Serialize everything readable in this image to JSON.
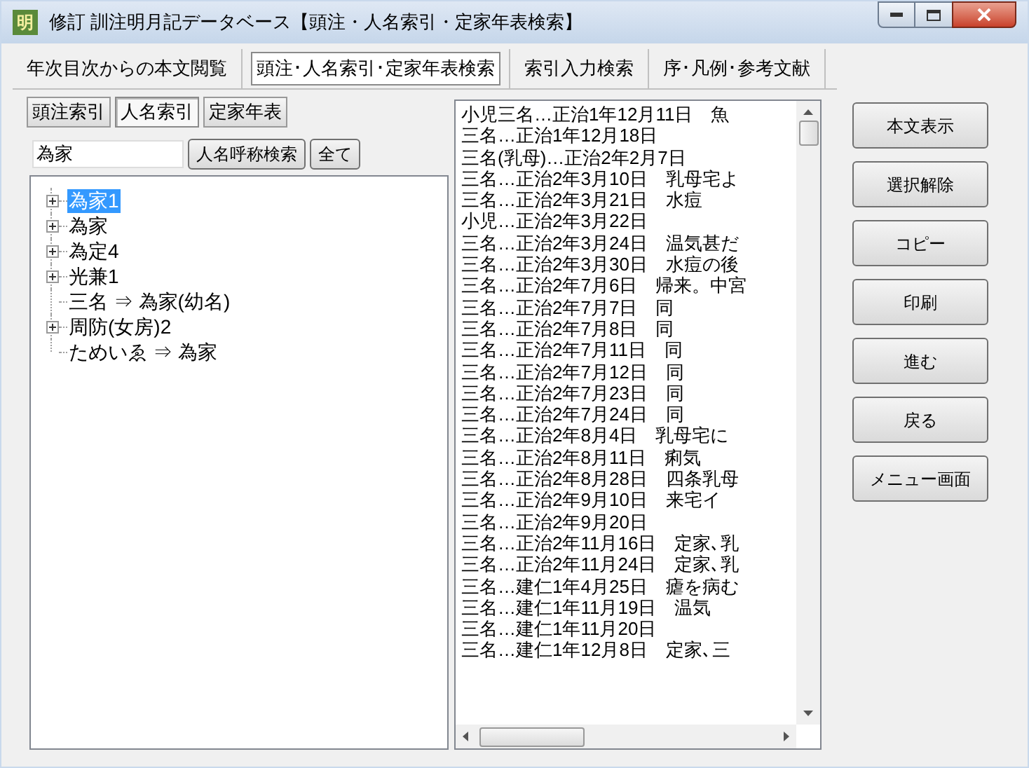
{
  "window": {
    "app_icon": "明",
    "title": "修訂 訓注明月記データベース【頭注・人名索引・定家年表検索】"
  },
  "tabs": [
    {
      "label": "年次目次からの本文閲覧",
      "selected": false
    },
    {
      "label": "頭注･人名索引･定家年表検索",
      "selected": true
    },
    {
      "label": "索引入力検索",
      "selected": false
    },
    {
      "label": "序･凡例･参考文献",
      "selected": false
    }
  ],
  "sub_tabs": [
    {
      "label": "頭注索引",
      "selected": false
    },
    {
      "label": "人名索引",
      "selected": true
    },
    {
      "label": "定家年表",
      "selected": false
    }
  ],
  "search": {
    "value": "為家",
    "buttons": [
      "人名呼称検索",
      "全て"
    ]
  },
  "tree": [
    {
      "label": "為家1",
      "expandable": true,
      "selected": true
    },
    {
      "label": "為家",
      "expandable": true,
      "selected": false
    },
    {
      "label": "為定4",
      "expandable": true,
      "selected": false
    },
    {
      "label": "光兼1",
      "expandable": true,
      "selected": false
    },
    {
      "label": "三名 ⇒ 為家(幼名)",
      "expandable": false,
      "selected": false
    },
    {
      "label": "周防(女房)2",
      "expandable": true,
      "selected": false
    },
    {
      "label": "ためいゑ ⇒ 為家",
      "expandable": false,
      "selected": false
    }
  ],
  "results": [
    "小児三名…正治1年12月11日　魚",
    "三名…正治1年12月18日",
    "三名(乳母)…正治2年2月7日",
    "三名…正治2年3月10日　乳母宅よ",
    "三名…正治2年3月21日　水痘",
    "小児…正治2年3月22日",
    "三名…正治2年3月24日　温気甚だ",
    "三名…正治2年3月30日　水痘の後",
    "三名…正治2年7月6日　帰来。中宮",
    "三名…正治2年7月7日　同",
    "三名…正治2年7月8日　同",
    "三名…正治2年7月11日　同",
    "三名…正治2年7月12日　同",
    "三名…正治2年7月23日　同",
    "三名…正治2年7月24日　同",
    "三名…正治2年8月4日　乳母宅に",
    "三名…正治2年8月11日　痢気",
    "三名…正治2年8月28日　四条乳母",
    "三名…正治2年9月10日　来宅イ",
    "三名…正治2年9月20日",
    "三名…正治2年11月16日　定家､乳",
    "三名…正治2年11月24日　定家､乳",
    "三名…建仁1年4月25日　瘧を病む",
    "三名…建仁1年11月19日　温気",
    "三名…建仁1年11月20日",
    "三名…建仁1年12月8日　定家､三"
  ],
  "actions": [
    "本文表示",
    "選択解除",
    "コピー",
    "印刷",
    "進む",
    "戻る",
    "メニュー画面"
  ]
}
